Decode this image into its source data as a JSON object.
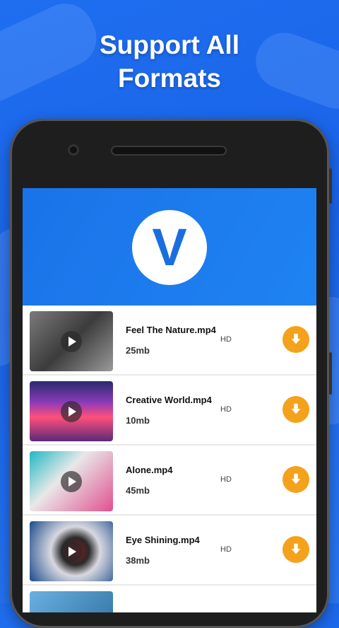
{
  "headline": {
    "line1": "Support All",
    "line2": "Formats"
  },
  "app": {
    "logo_letter": "V"
  },
  "videos": [
    {
      "title": "Feel The Nature.mp4",
      "size": "25mb",
      "quality": "HD"
    },
    {
      "title": "Creative World.mp4",
      "size": "10mb",
      "quality": "HD"
    },
    {
      "title": "Alone.mp4",
      "size": "45mb",
      "quality": "HD"
    },
    {
      "title": "Eye Shining.mp4",
      "size": "38mb",
      "quality": "HD"
    }
  ],
  "colors": {
    "background": "#1f6ef0",
    "header": "#1a73e8",
    "download_button": "#f4a21b"
  },
  "icons": [
    "play-icon",
    "download-arrow-icon"
  ]
}
